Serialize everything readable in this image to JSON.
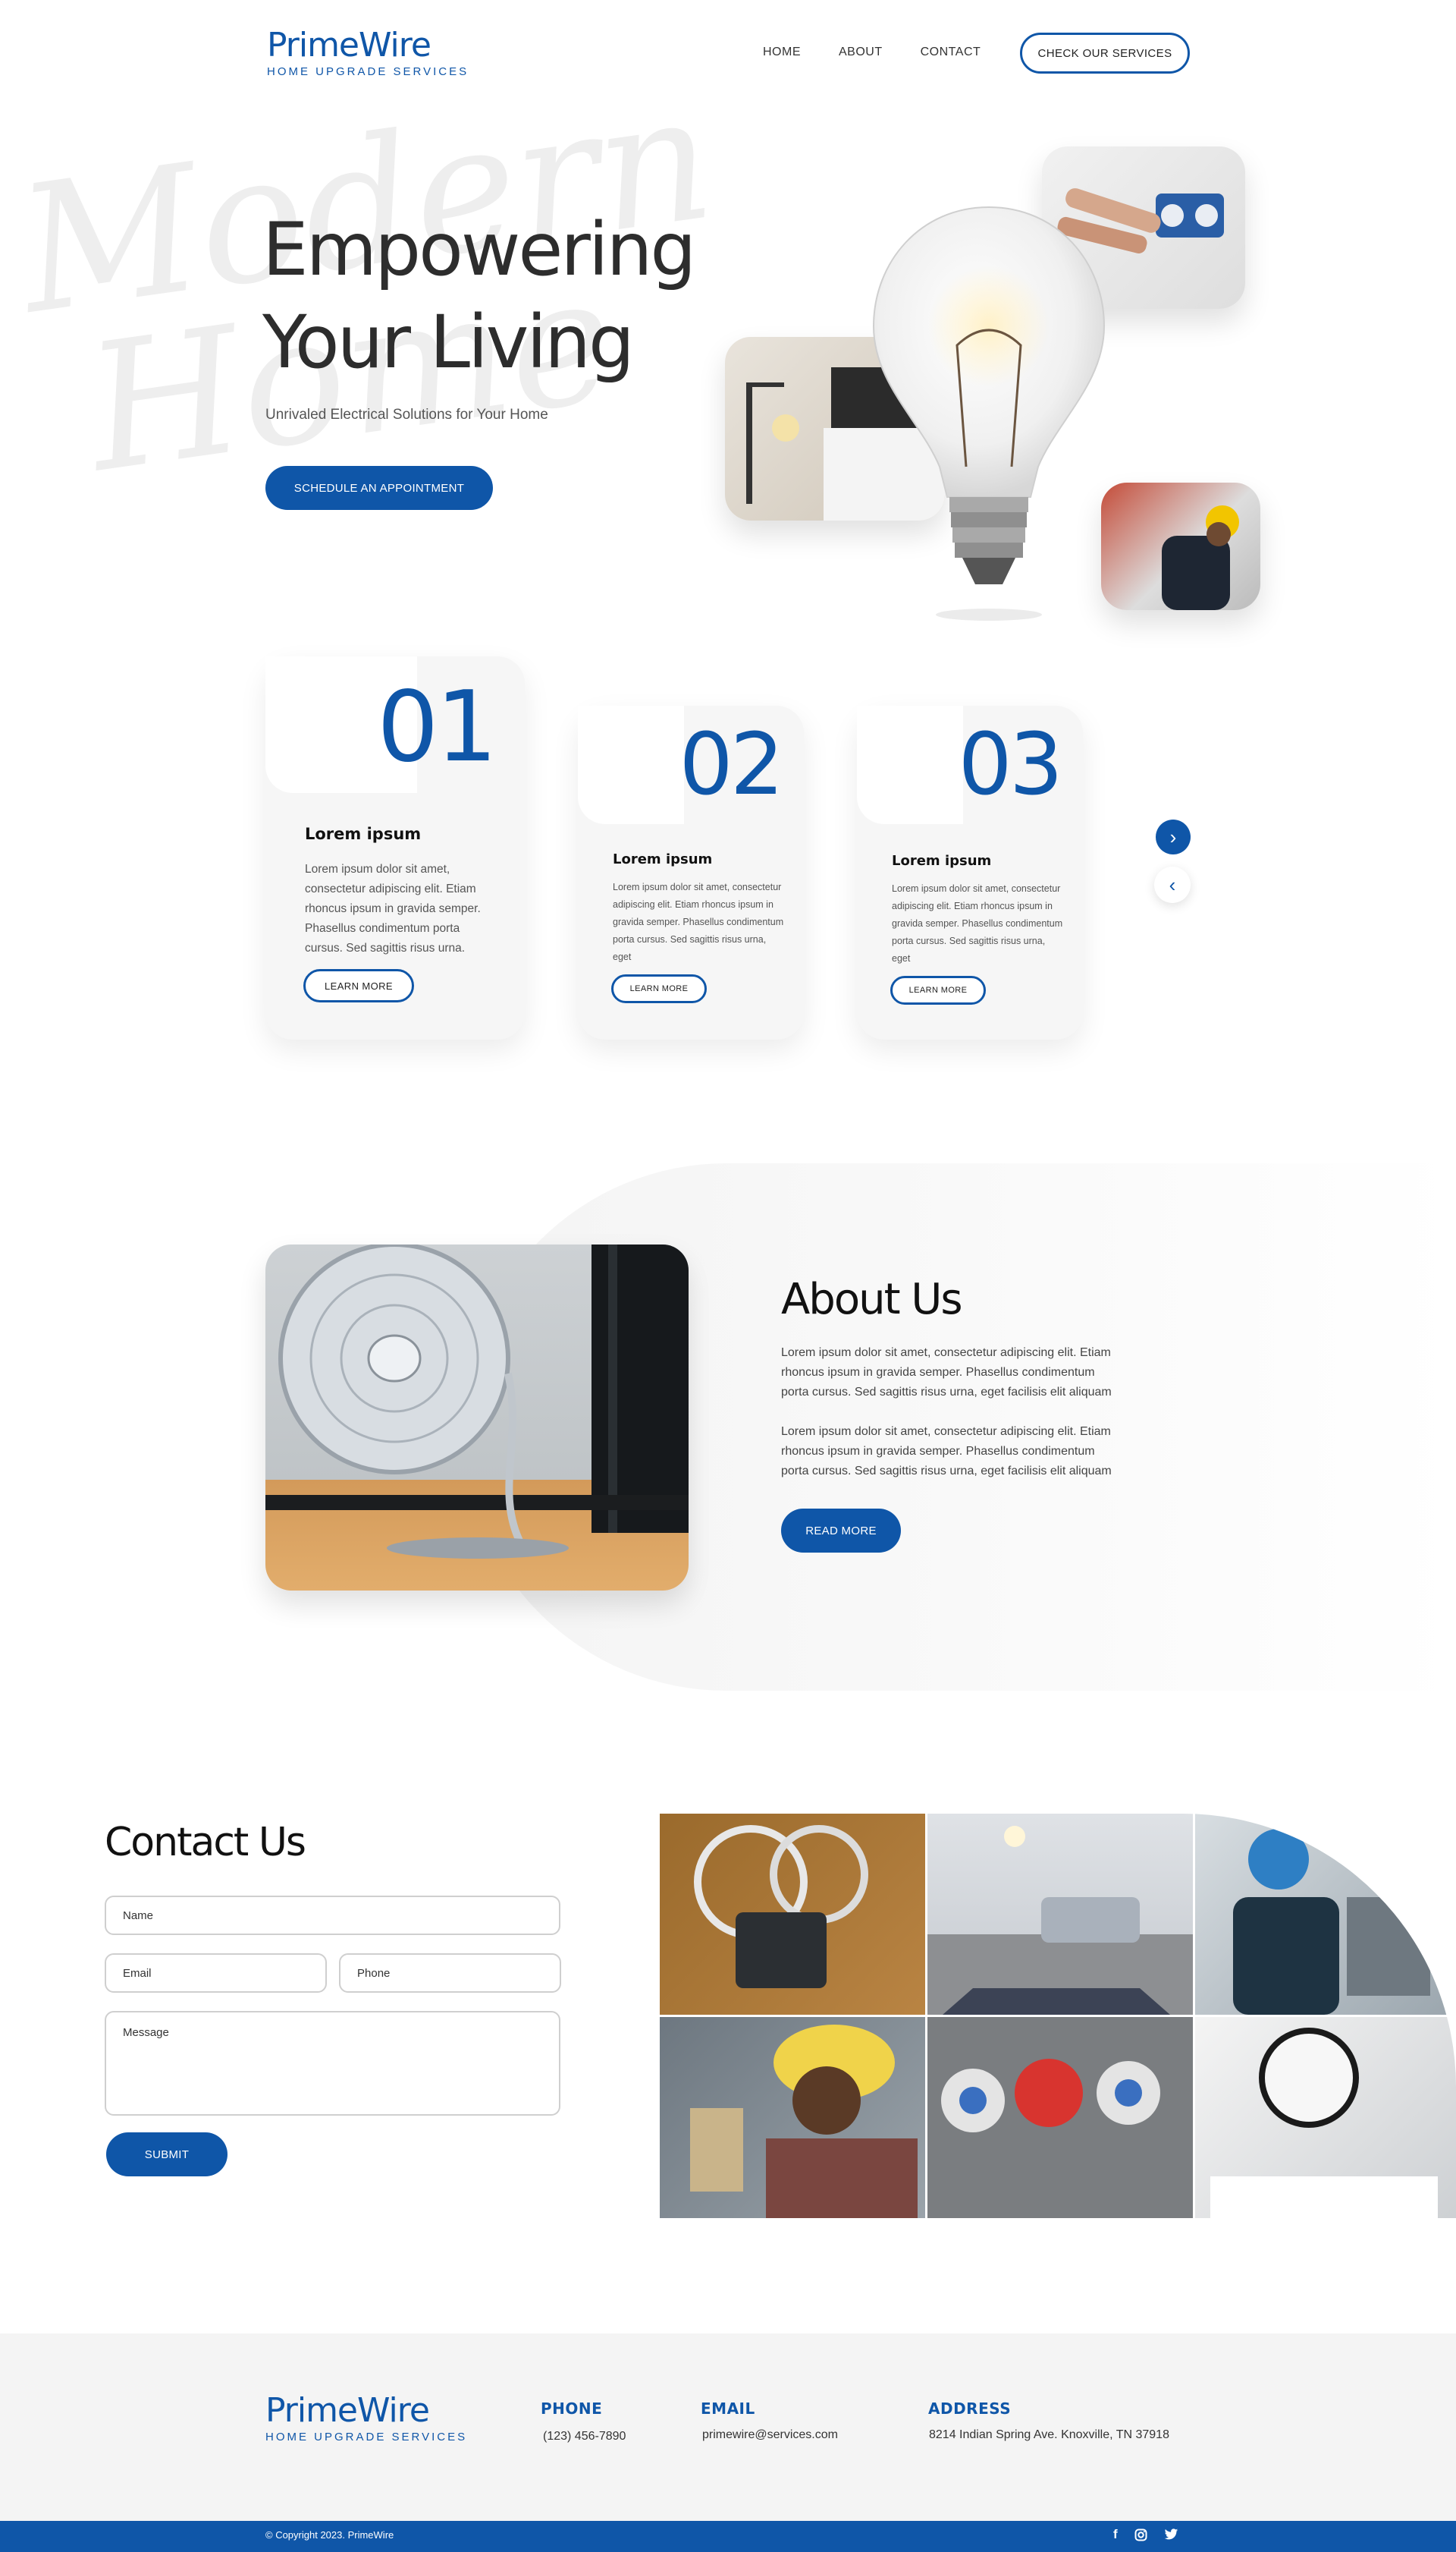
{
  "header": {
    "logo_name": "PrimeWire",
    "logo_tagline": "HOME UPGRADE SERVICES",
    "nav": [
      "HOME",
      "ABOUT",
      "CONTACT"
    ],
    "cta": "CHECK OUR SERVICES"
  },
  "hero": {
    "title_line1": "Empowering",
    "title_line2": "Your Living",
    "subtitle": "Unrivaled Electrical Solutions for Your Home",
    "cta": "SCHEDULE AN APPOINTMENT",
    "watermark_line1": "Modern",
    "watermark_line2": "Home"
  },
  "steps": [
    {
      "number": "01",
      "title": "Lorem ipsum",
      "text": "Lorem ipsum dolor sit amet, consectetur adipiscing elit. Etiam rhoncus ipsum in gravida semper. Phasellus condimentum porta cursus. Sed sagittis risus urna.",
      "button": "LEARN MORE"
    },
    {
      "number": "02",
      "title": "Lorem ipsum",
      "text": "Lorem ipsum dolor sit amet, consectetur adipiscing elit. Etiam rhoncus ipsum in gravida semper. Phasellus condimentum porta cursus. Sed sagittis risus urna, eget",
      "button": "LEARN MORE"
    },
    {
      "number": "03",
      "title": "Lorem ipsum",
      "text": "Lorem ipsum dolor sit amet, consectetur adipiscing elit. Etiam rhoncus ipsum in gravida semper. Phasellus condimentum porta cursus. Sed sagittis risus urna, eget",
      "button": "LEARN MORE"
    }
  ],
  "carousel": {
    "next_icon": "chevron-right-icon",
    "prev_icon": "chevron-left-icon"
  },
  "about": {
    "title": "About Us",
    "paragraph1": "Lorem ipsum dolor sit amet, consectetur adipiscing elit. Etiam rhoncus ipsum in gravida semper. Phasellus condimentum porta cursus. Sed sagittis risus urna, eget facilisis elit aliquam",
    "paragraph2": "Lorem ipsum dolor sit amet, consectetur adipiscing elit. Etiam rhoncus ipsum in gravida semper. Phasellus condimentum porta cursus. Sed sagittis risus urna, eget facilisis elit aliquam",
    "cta": "READ MORE"
  },
  "contact": {
    "title": "Contact Us",
    "name_placeholder": "Name",
    "email_placeholder": "Email",
    "phone_placeholder": "Phone",
    "message_placeholder": "Message",
    "submit": "SUBMIT"
  },
  "footer": {
    "logo_name": "PrimeWire",
    "logo_tagline": "HOME UPGRADE SERVICES",
    "phone_label": "PHONE",
    "phone_value": "(123) 456-7890",
    "email_label": "EMAIL",
    "email_value": "primewire@services.com",
    "address_label": "ADDRESS",
    "address_value": "8214 Indian Spring Ave. Knoxville, TN 37918",
    "copyright": "© Copyright 2023. PrimeWire",
    "social": [
      "facebook-icon",
      "instagram-icon",
      "twitter-icon"
    ]
  },
  "colors": {
    "brand_blue": "#0f56a8",
    "card_bg": "#f6f6f6",
    "footer_bg": "#f4f4f4"
  }
}
